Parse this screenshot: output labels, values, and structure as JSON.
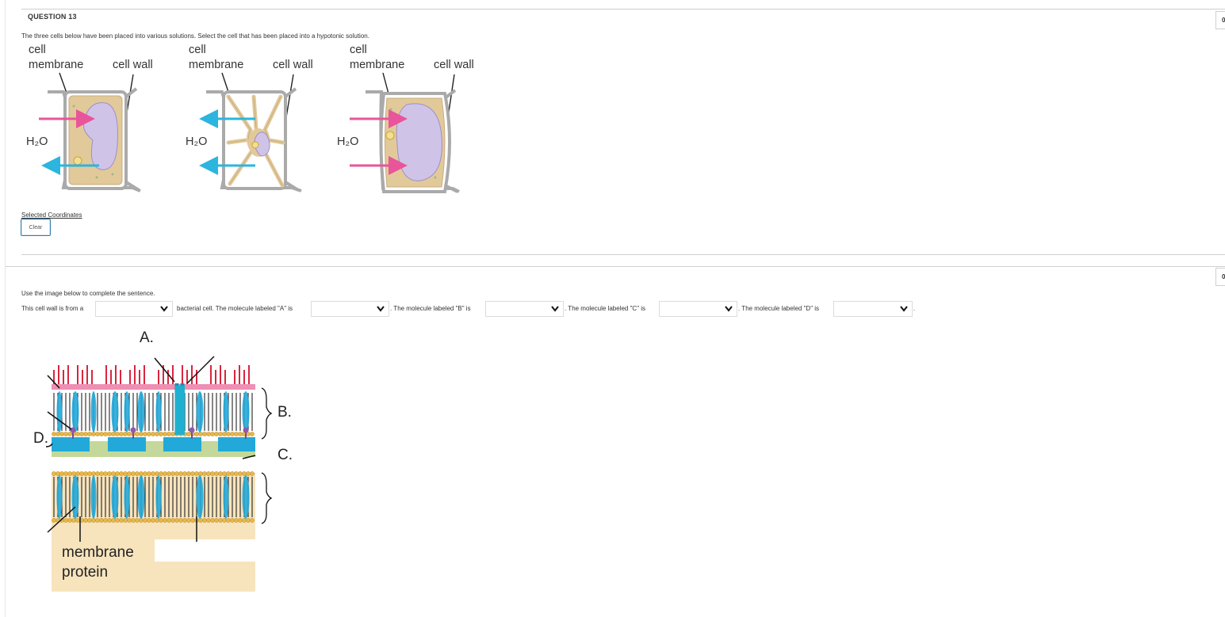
{
  "question13": {
    "title": "QUESTION 13",
    "prompt": "The three cells below have been placed into various solutions. Select the cell that has been placed into a hypotonic solution.",
    "cell_labels": {
      "membrane": [
        "cell",
        "membrane"
      ],
      "wall": "cell wall",
      "water": "H₂O"
    },
    "selected_coordinates": "Selected Coordinates",
    "clear_label": "Clear",
    "points": "0"
  },
  "question14": {
    "points": "0",
    "prompt": "Use the image below to complete the sentence.",
    "sentence": {
      "part1": "This cell wall is from a",
      "part2": "bacterial cell. The molecule labeled \"A\" is",
      "part3": ". The molecule labeled \"B\" is",
      "part4": ". The molecule labeled \"C\" is",
      "part5": ". The molecule labeled \"D\" is",
      "part6": "."
    },
    "dropdowns": [
      "",
      "",
      "",
      "",
      ""
    ],
    "diagram": {
      "label_a": "A.",
      "label_b": "B.",
      "label_c": "C.",
      "label_d": "D.",
      "protein_label": [
        "membrane",
        "protein"
      ]
    }
  },
  "colors": {
    "pink_arrow": "#e8559a",
    "blue_arrow": "#2cb5de",
    "cytoplasm": "#e2c99a",
    "vacuole": "#cfc4e8",
    "wall_gray": "#a9a9a9",
    "lps_red": "#d9263f",
    "peptidoglycan_green": "#c3d89a",
    "protein_blue": "#22a9d9",
    "lipid_head": "#e8b84a",
    "periplasm": "#f7e4bd"
  },
  "icons": {
    "dropdown": "chevron-down-icon"
  }
}
